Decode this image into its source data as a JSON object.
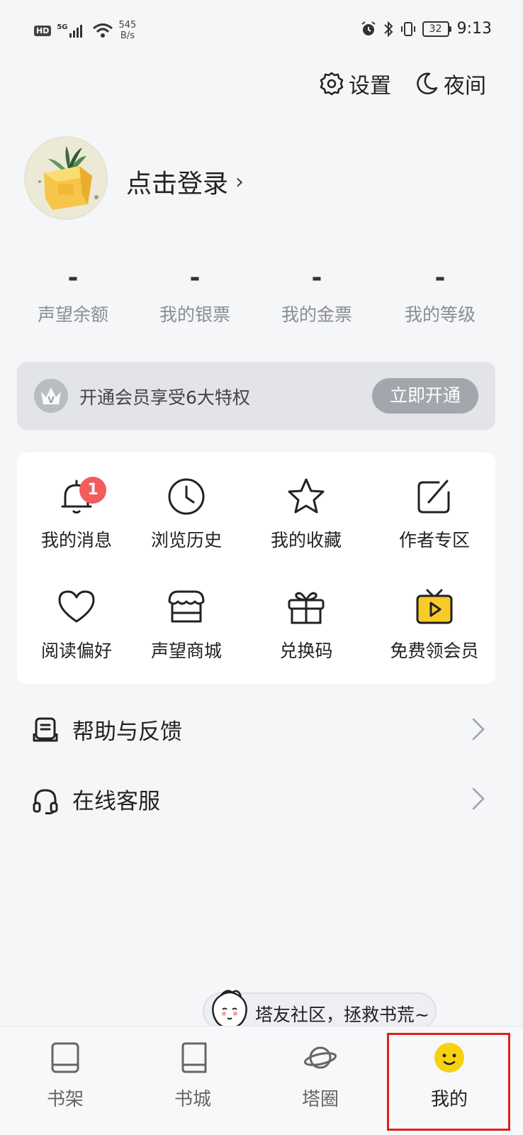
{
  "status_bar": {
    "hd": "HD",
    "signal": "5G",
    "net_speed_value": "545",
    "net_speed_unit": "B/s",
    "battery": "32",
    "time": "9:13"
  },
  "header": {
    "settings_label": "设置",
    "night_label": "夜间"
  },
  "profile": {
    "login_label": "点击登录",
    "login_chevron": "›"
  },
  "stats": [
    {
      "value": "-",
      "label": "声望余额"
    },
    {
      "value": "-",
      "label": "我的银票"
    },
    {
      "value": "-",
      "label": "我的金票"
    },
    {
      "value": "-",
      "label": "我的等级"
    }
  ],
  "vip": {
    "text": "开通会员享受6大特权",
    "button": "立即开通",
    "icon_letter": "V"
  },
  "grid": [
    {
      "label": "我的消息",
      "icon": "bell-icon",
      "badge": "1"
    },
    {
      "label": "浏览历史",
      "icon": "clock-icon"
    },
    {
      "label": "我的收藏",
      "icon": "star-icon"
    },
    {
      "label": "作者专区",
      "icon": "edit-icon"
    },
    {
      "label": "阅读偏好",
      "icon": "heart-icon"
    },
    {
      "label": "声望商城",
      "icon": "shop-icon"
    },
    {
      "label": "兑换码",
      "icon": "gift-icon"
    },
    {
      "label": "免费领会员",
      "icon": "tv-play-icon"
    }
  ],
  "list": [
    {
      "label": "帮助与反馈",
      "icon": "feedback-icon"
    },
    {
      "label": "在线客服",
      "icon": "headset-icon"
    }
  ],
  "community": {
    "text": "塔友社区，拯救书荒~"
  },
  "bottom_nav": [
    {
      "label": "书架",
      "icon": "bookshelf-icon"
    },
    {
      "label": "书城",
      "icon": "bookstore-icon"
    },
    {
      "label": "塔圈",
      "icon": "planet-icon"
    },
    {
      "label": "我的",
      "icon": "smiley-icon",
      "active": true
    }
  ],
  "colors": {
    "background": "#f5f6f8",
    "badge": "#f45b5b",
    "active_tab": "#f9d20f",
    "highlight": "#e0211b"
  }
}
